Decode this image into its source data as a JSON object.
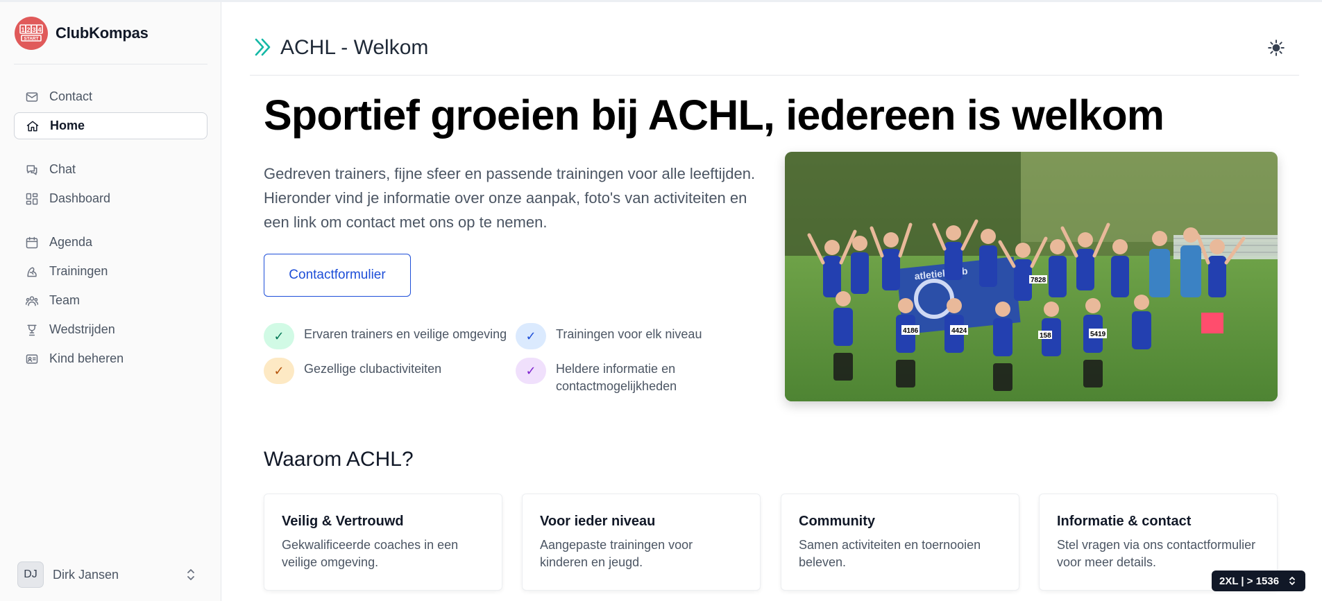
{
  "app": {
    "brand_name": "ClubKompas",
    "logo_digits": [
      "1",
      "2",
      "3",
      "4"
    ],
    "logo_word": "START"
  },
  "sidebar": {
    "items": [
      {
        "label": "Contact",
        "icon": "mail-icon"
      },
      {
        "label": "Home",
        "icon": "home-icon",
        "active": true
      },
      {
        "label": "Chat",
        "icon": "chat-icon"
      },
      {
        "label": "Dashboard",
        "icon": "dashboard-icon"
      },
      {
        "label": "Agenda",
        "icon": "calendar-icon"
      },
      {
        "label": "Trainingen",
        "icon": "trainingen-icon"
      },
      {
        "label": "Team",
        "icon": "team-icon"
      },
      {
        "label": "Wedstrijden",
        "icon": "trophy-icon"
      },
      {
        "label": "Kind beheren",
        "icon": "id-card-icon"
      }
    ]
  },
  "user": {
    "initials": "DJ",
    "name": "Dirk Jansen"
  },
  "header": {
    "title": "ACHL - Welkom",
    "theme_icon": "sun-icon"
  },
  "hero": {
    "title": "Sportief groeien bij ACHL, iedereen is welkom",
    "text": "Gedreven trainers, fijne sfeer en passende trainingen voor alle leeftijden. Hieronder vind je informatie over onze aanpak, foto's van activiteiten en een link om contact met ons op te nemen.",
    "button_label": "Contactformulier",
    "features": [
      {
        "label": "Ervaren trainers en veilige omgeving",
        "color": "#d1fae5"
      },
      {
        "label": "Trainingen voor elk niveau",
        "color": "#dbeafe"
      },
      {
        "label": "Gezellige clubactiviteiten",
        "color": "#fde9c4"
      },
      {
        "label": "Heldere informatie en contactmogelijkheden",
        "color": "#f0e0fc"
      }
    ],
    "check_glyph": "✓",
    "photo_banner_text": "atletiekclub",
    "bib_numbers": [
      "4186",
      "4424",
      "5419",
      "7828",
      "158"
    ]
  },
  "why": {
    "title": "Waarom ACHL?",
    "cards": [
      {
        "title": "Veilig & Vertrouwd",
        "text": "Gekwalificeerde coaches in een veilige omgeving."
      },
      {
        "title": "Voor ieder niveau",
        "text": "Aangepaste trainingen voor kinderen en jeugd."
      },
      {
        "title": "Community",
        "text": "Samen activiteiten en toernooien beleven."
      },
      {
        "title": "Informatie & contact",
        "text": "Stel vragen via ons contactformulier voor meer details."
      }
    ]
  },
  "breakpoint_badge": "2XL | > 1536",
  "colors": {
    "accent_teal": "#14b8a6",
    "link_blue": "#1d4ed8",
    "logo_red": "#e05a5a"
  }
}
